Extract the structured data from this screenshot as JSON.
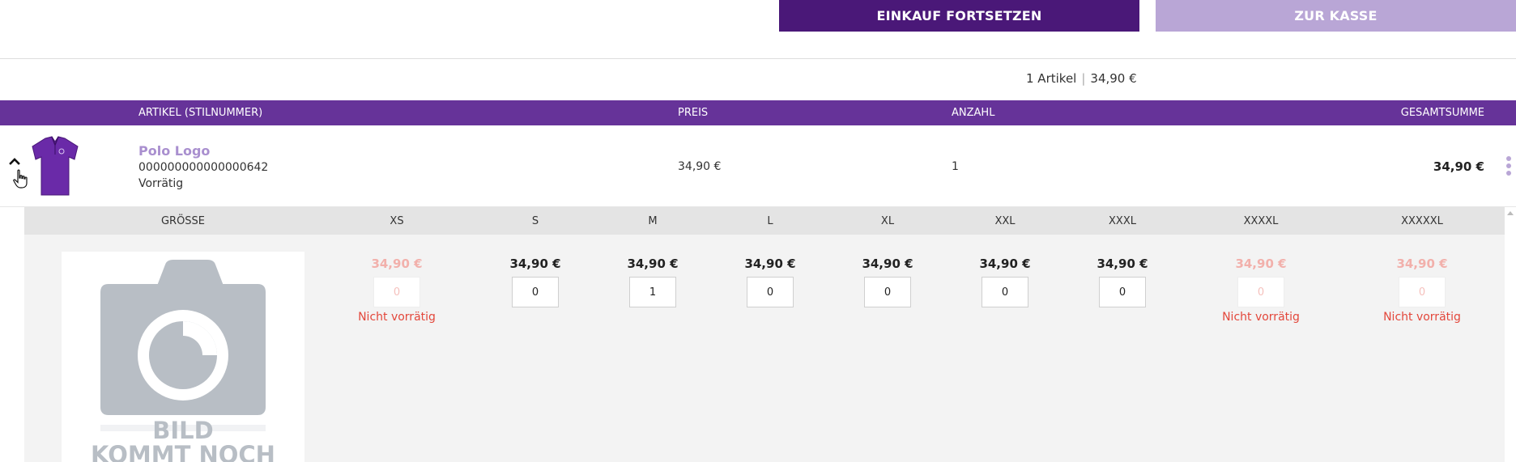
{
  "buttons": {
    "continue_label": "EINKAUF FORTSETZEN",
    "checkout_label": "ZUR KASSE"
  },
  "summary": {
    "count_label": "1 Artikel",
    "separator": "|",
    "total": "34,90 €"
  },
  "table_header": {
    "article": "ARTIKEL (STILNUMMER)",
    "price": "PREIS",
    "quantity": "ANZAHL",
    "total": "GESAMTSUMME"
  },
  "item": {
    "name": "Polo Logo",
    "sku": "000000000000000642",
    "stock": "Vorrätig",
    "price": "34,90 €",
    "quantity": "1",
    "total": "34,90 €",
    "image_icon": "polo-shirt-icon"
  },
  "variants": {
    "size_label": "GRÖSSE",
    "out_of_stock_label": "Nicht vorrätig",
    "placeholder_text": [
      "BILD",
      "KOMMT NOCH"
    ],
    "sizes": [
      {
        "size": "XS",
        "price": "34,90 €",
        "value": "0",
        "available": false
      },
      {
        "size": "S",
        "price": "34,90 €",
        "value": "0",
        "available": true
      },
      {
        "size": "M",
        "price": "34,90 €",
        "value": "1",
        "available": true
      },
      {
        "size": "L",
        "price": "34,90 €",
        "value": "0",
        "available": true
      },
      {
        "size": "XL",
        "price": "34,90 €",
        "value": "0",
        "available": true
      },
      {
        "size": "XXL",
        "price": "34,90 €",
        "value": "0",
        "available": true
      },
      {
        "size": "XXXL",
        "price": "34,90 €",
        "value": "0",
        "available": true
      },
      {
        "size": "XXXXL",
        "price": "34,90 €",
        "value": "0",
        "available": false
      },
      {
        "size": "XXXXXL",
        "price": "34,90 €",
        "value": "0",
        "available": false
      }
    ]
  },
  "colors": {
    "primary_dark": "#4a1878",
    "primary": "#663399",
    "primary_light": "#b9a6d6",
    "error": "#e3473b"
  }
}
